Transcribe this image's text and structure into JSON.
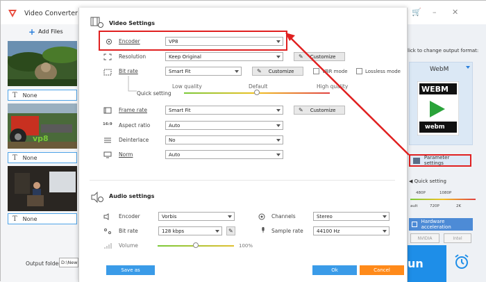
{
  "app": {
    "title": "Video Converter",
    "add_files": "Add Files",
    "cart_icon": "cart-icon"
  },
  "file_list": {
    "items": [
      {
        "subtitle": "None"
      },
      {
        "subtitle": "None",
        "overlay_text": "vp8"
      },
      {
        "subtitle": "None"
      }
    ]
  },
  "output": {
    "label": "Output folder:",
    "path": "D:\\New f"
  },
  "right_panel": {
    "hint": "lick to change output format:",
    "format": "WebM",
    "format_icon_top": "WEBM",
    "format_icon_bottom": "webm",
    "parameter_settings": "Parameter settings",
    "quick_setting": "Quick setting",
    "scale_top": [
      "480P",
      "1080P"
    ],
    "scale_bottom": [
      "ault",
      "720P",
      "2K"
    ],
    "hardware_acceleration": "Hardware acceleration",
    "gpu": [
      "NVIDIA",
      "Intel"
    ],
    "run": "un"
  },
  "dialog": {
    "video_title": "Video Settings",
    "encoder": {
      "label": "Encoder",
      "value": "VP8"
    },
    "resolution": {
      "label": "Resolution",
      "value": "Keep Original",
      "btn": "Customize"
    },
    "bitrate": {
      "label": "Bit rate",
      "value": "Smart Fit",
      "btn": "Customize",
      "vbr": "VBR mode",
      "lossless": "Lossless mode"
    },
    "quick_setting": {
      "label": "Quick setting",
      "low": "Low quality",
      "default": "Default",
      "high": "High quality",
      "level": 0.5
    },
    "frame_rate": {
      "label": "Frame rate",
      "value": "Smart Fit",
      "btn": "Customize"
    },
    "aspect_ratio": {
      "label": "Aspect ratio",
      "value": "Auto",
      "icon_text": "16:9"
    },
    "deinterlace": {
      "label": "Deinterlace",
      "value": "No"
    },
    "norm": {
      "label": "Norm",
      "value": "Auto"
    },
    "audio_title": "Audio settings",
    "a_encoder": {
      "label": "Encoder",
      "value": "Vorbis"
    },
    "a_channels": {
      "label": "Channels",
      "value": "Stereo"
    },
    "a_bitrate": {
      "label": "Bit rate",
      "value": "128 kbps"
    },
    "a_samplerate": {
      "label": "Sample rate",
      "value": "44100 Hz"
    },
    "a_volume": {
      "label": "Volume",
      "value": "100%",
      "level": 0.5
    },
    "save_as": "Save as",
    "ok": "Ok",
    "cancel": "Cancel"
  },
  "colors": {
    "accent": "#1e8ee8",
    "highlight": "#e02020",
    "cancel": "#ff8a1a"
  }
}
